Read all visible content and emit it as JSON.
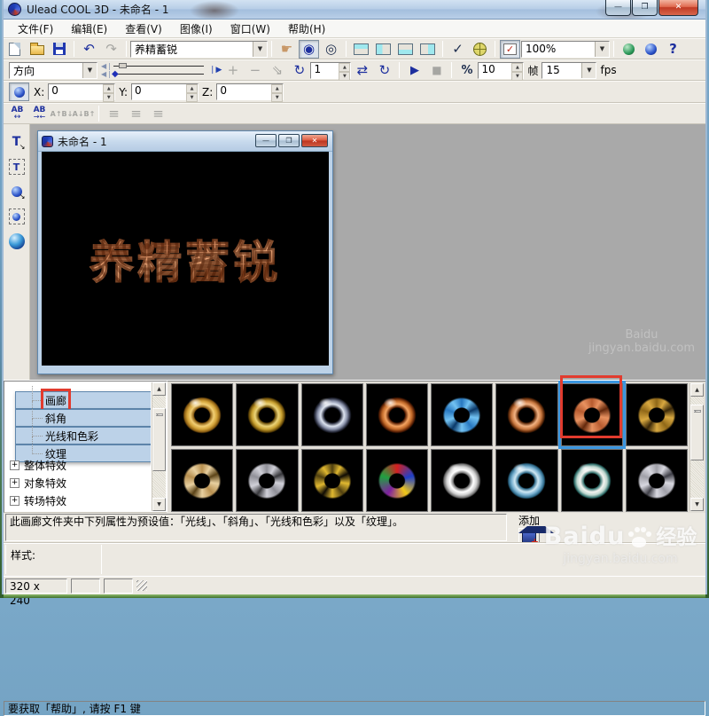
{
  "window": {
    "title": "Ulead COOL 3D - 未命名 - 1"
  },
  "menu": {
    "items": [
      {
        "label": "文件(F)"
      },
      {
        "label": "编辑(E)"
      },
      {
        "label": "查看(V)"
      },
      {
        "label": "图像(I)"
      },
      {
        "label": "窗口(W)"
      },
      {
        "label": "帮助(H)"
      }
    ]
  },
  "toolbar_top": {
    "preset_combo": "养精蓄锐",
    "zoom_combo": "100%"
  },
  "toolbar_anim": {
    "mode_combo": "方向",
    "current_frame": "1",
    "total_frames": "10",
    "frames_unit": "帧",
    "fps_value": "15",
    "fps_unit": "fps"
  },
  "toolbar_position": {
    "x_label": "X:",
    "x_value": "0",
    "y_label": "Y:",
    "y_value": "0",
    "z_label": "Z:",
    "z_value": "0"
  },
  "child_window": {
    "title": "未命名 - 1",
    "canvas_text": "养精蓄锐"
  },
  "attribute_tree": {
    "items": [
      {
        "label": "画廊",
        "annotated": true
      },
      {
        "label": "斜角"
      },
      {
        "label": "光线和色彩"
      },
      {
        "label": "纹理"
      },
      {
        "label": "整体特效",
        "expandable": true
      },
      {
        "label": "对象特效",
        "expandable": true
      },
      {
        "label": "转场特效",
        "expandable": true
      }
    ]
  },
  "gallery": {
    "rows": [
      [
        {
          "name": "gold-smooth-torus",
          "type": "smooth",
          "colors": [
            "#f2cf74",
            "#d2a238",
            "#8a5c12"
          ]
        },
        {
          "name": "brass-ring-torus",
          "type": "smooth",
          "colors": [
            "#ecd478",
            "#c8a030",
            "#6a4c08"
          ]
        },
        {
          "name": "chrome-dark-torus",
          "type": "smooth",
          "colors": [
            "#dde4f0",
            "#8890a8",
            "#282c3c"
          ]
        },
        {
          "name": "copper-shiny-torus",
          "type": "smooth",
          "colors": [
            "#f4a462",
            "#c06828",
            "#581f04"
          ]
        },
        {
          "name": "blue-bumpy-torus",
          "type": "lumpy",
          "colors": [
            "#72c2f2",
            "#2878c0",
            "#0a3868"
          ]
        },
        {
          "name": "copper-ring-torus",
          "type": "smooth",
          "colors": [
            "#f2b282",
            "#c87840",
            "#5c2808"
          ]
        },
        {
          "name": "copper-bumpy-torus",
          "type": "lumpy",
          "colors": [
            "#e89260",
            "#b85c30",
            "#63280c"
          ],
          "selected": true,
          "annotated": true
        },
        {
          "name": "gold-carved-torus",
          "type": "lumpy",
          "colors": [
            "#d8a840",
            "#906818",
            "#3a2808"
          ]
        }
      ],
      [
        {
          "name": "tan-bumpy-torus",
          "type": "lumpy",
          "colors": [
            "#e8d0a0",
            "#b89050",
            "#5c4418"
          ]
        },
        {
          "name": "steel-slotted-torus",
          "type": "lumpy",
          "colors": [
            "#d0d0d8",
            "#909098",
            "#38383c"
          ]
        },
        {
          "name": "black-gold-torus",
          "type": "lumpy",
          "colors": [
            "#e0b830",
            "#504010",
            "#100c04"
          ]
        },
        {
          "name": "stained-glass-torus",
          "type": "conic",
          "colors": [
            "#d42020",
            "#2040c8",
            "#f0c818",
            "#8020a0",
            "#20a040",
            "#d42020"
          ]
        },
        {
          "name": "white-ceramic-torus",
          "type": "smooth",
          "colors": [
            "#ffffff",
            "#d0d0d0",
            "#707070"
          ]
        },
        {
          "name": "blue-glass-torus",
          "type": "smooth",
          "colors": [
            "#d0e8f4",
            "#78b0d0",
            "#2c6888"
          ]
        },
        {
          "name": "pearl-teal-torus",
          "type": "smooth",
          "colors": [
            "#f4f4f0",
            "#c0d8d0",
            "#30706c"
          ]
        },
        {
          "name": "steel-holes-torus",
          "type": "lumpy",
          "colors": [
            "#d8d8e0",
            "#a0a0a8",
            "#404048"
          ]
        }
      ]
    ]
  },
  "description": {
    "text": "此画廊文件夹中下列属性为预设值：「光线」、「斜角」、「光线和色彩」以及「纹理」。",
    "add_label": "添加"
  },
  "style_panel": {
    "label": "样式:"
  },
  "status_bar": {
    "help_text": "要获取「帮助」, 请按 F1 键",
    "canvas_size": "320 x 240"
  },
  "watermark": {
    "brand": "Baidu",
    "brand_cn": "经验",
    "url": "jingyan.baidu.com"
  },
  "colors": {
    "annotation_red": "#e23b2e",
    "selection_blue": "#3b96e0"
  },
  "icons": {
    "undo": "↶",
    "redo": "↷",
    "hand": "☛",
    "rotate_object": "◉",
    "orbit": "◎",
    "repeat": "⇄",
    "rotate_loop": "↻",
    "play": "▶",
    "stop": "■",
    "percent": "%",
    "plus": "+",
    "minus": "−",
    "flip": "⇘",
    "help": "?",
    "check": "✓",
    "min": "—",
    "max": "❐",
    "close": "✕",
    "spin_up": "▲",
    "spin_down": "▼",
    "dropdown_arrow": "▼",
    "scroll_up": "▲",
    "scroll_down": "▼",
    "tree_expand": "+",
    "align": "≡",
    "ab_wide": "AB",
    "arrow_lr": "↔",
    "arrow_in": "→←",
    "a_up": "A↑B↓",
    "a_dn": "A↓B↑",
    "slider_l": "◀❘",
    "slider_r": "❘▶"
  }
}
